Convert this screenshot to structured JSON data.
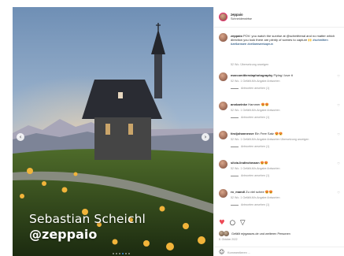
{
  "photo": {
    "credit_name": "Sebastian Scheichl",
    "credit_handle": "@zeppaio"
  },
  "post": {
    "username": "zeppaio",
    "location": "Schneiderwirtse",
    "caption_user": "zeppaio",
    "caption_text": "POV: you watch the sunrise at @schmittenal and no matter which direction you look there are plenty of scenes to capture 🙌",
    "caption_tags": "#schmitten #zellamsee #zellamseekaprun",
    "caption_meta": "52 Wo.   Übersetzung anzeigen"
  },
  "comments": [
    {
      "user": "marcomitterstaphotography",
      "text": "Flying i love it",
      "meta": "52 Wo.   1 Gefällt-Mir-Angabe   Antworten",
      "replies": "Antworten ansehen (1)"
    },
    {
      "user": "annkarinke",
      "text": "Hammer 😍😍",
      "meta": "52 Wo.   1 Gefällt-Mir-Angabe   Antworten",
      "replies": "Antworten ansehen (1)"
    },
    {
      "user": "tiroljohannesve",
      "text": "Ein Free Satz 😍😍",
      "meta": "52 Wo.   1 Gefällt-Mir-Angabe   Antworten   Übersetzung anzeigen",
      "replies": "Antworten ansehen (1)"
    },
    {
      "user": "silvia.lindtrohmann",
      "text": "😍😍",
      "meta": "52 Wo.   1 Gefällt-Mir-Angabe   Antworten",
      "replies": "Antworten ansehen (1)"
    },
    {
      "user": "ro_mandl",
      "text": "Zu viel schee 😍😍",
      "meta": "52 Wo.   1 Gefällt-Mir-Angabe   Antworten",
      "replies": "Antworten ansehen (1)"
    }
  ],
  "actions": {
    "like_icon": "heart-icon",
    "comment_icon": "comment-icon",
    "share_icon": "share-icon"
  },
  "likes_text": "Gefällt mjrgasses.de und weiteren Personen",
  "date_text": "8. Oktober 2022",
  "add_comment": {
    "placeholder": "Kommentieren ..."
  },
  "colors": {
    "like": "#ed4956",
    "muted": "#8e8e8e",
    "text": "#262626",
    "link": "#00376b"
  },
  "carousel": {
    "count": 6,
    "active": 3
  }
}
